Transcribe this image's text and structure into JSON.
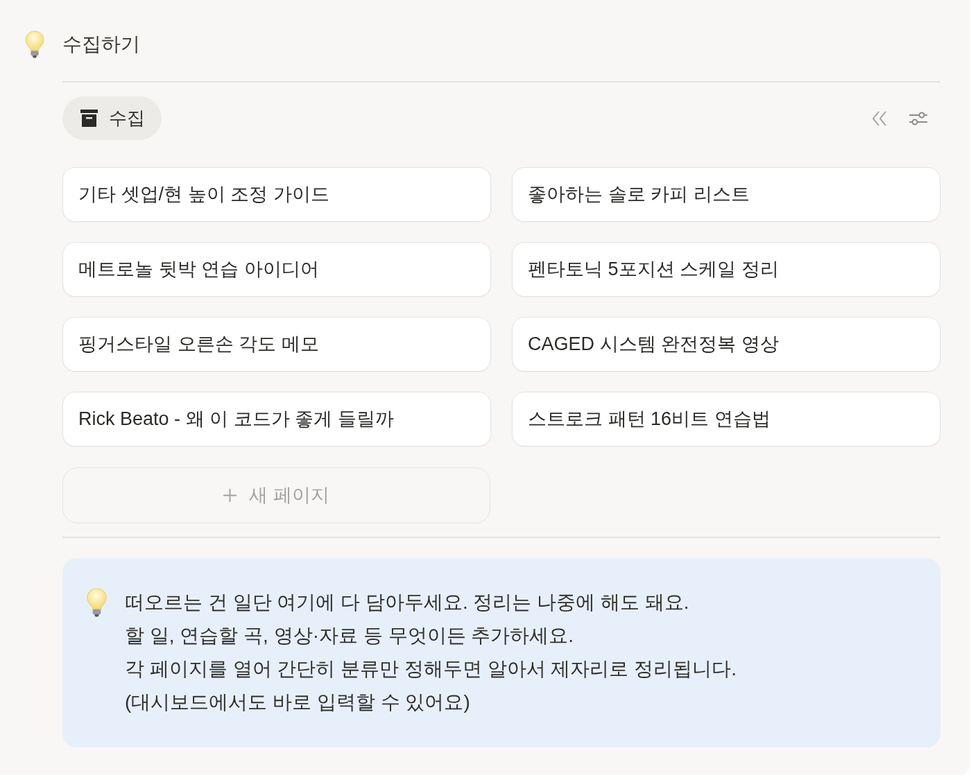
{
  "header": {
    "title": "수집하기"
  },
  "view_tabs": [
    {
      "label": "수집",
      "selected": true
    }
  ],
  "cards": [
    {
      "title": "기타 셋업/현 높이 조정 가이드"
    },
    {
      "title": "좋아하는 솔로 카피 리스트"
    },
    {
      "title": "메트로놀 뒷박 연습 아이디어"
    },
    {
      "title": "펜타토닉 5포지션 스케일 정리"
    },
    {
      "title": "핑거스타일 오른손 각도 메모"
    },
    {
      "title": "CAGED 시스템 완전정복 영상"
    },
    {
      "title": "Rick Beato - 왜 이 코드가 좋게 들릴까"
    },
    {
      "title": "스트로크 패턴 16비트 연습법"
    }
  ],
  "new_page_button": {
    "label": "새 페이지"
  },
  "callout": {
    "lines": [
      "떠오르는 건 일단 여기에 다 담아두세요. 정리는 나중에 해도 돼요.",
      "할 일, 연습할 곡, 영상·자료 등 무엇이든 추가하세요.",
      "각 페이지를 열어 간단히 분류만 정해두면 알아서 제자리로 정리됩니다.",
      "(대시보드에서도 바로 입력할 수 있어요)"
    ]
  }
}
